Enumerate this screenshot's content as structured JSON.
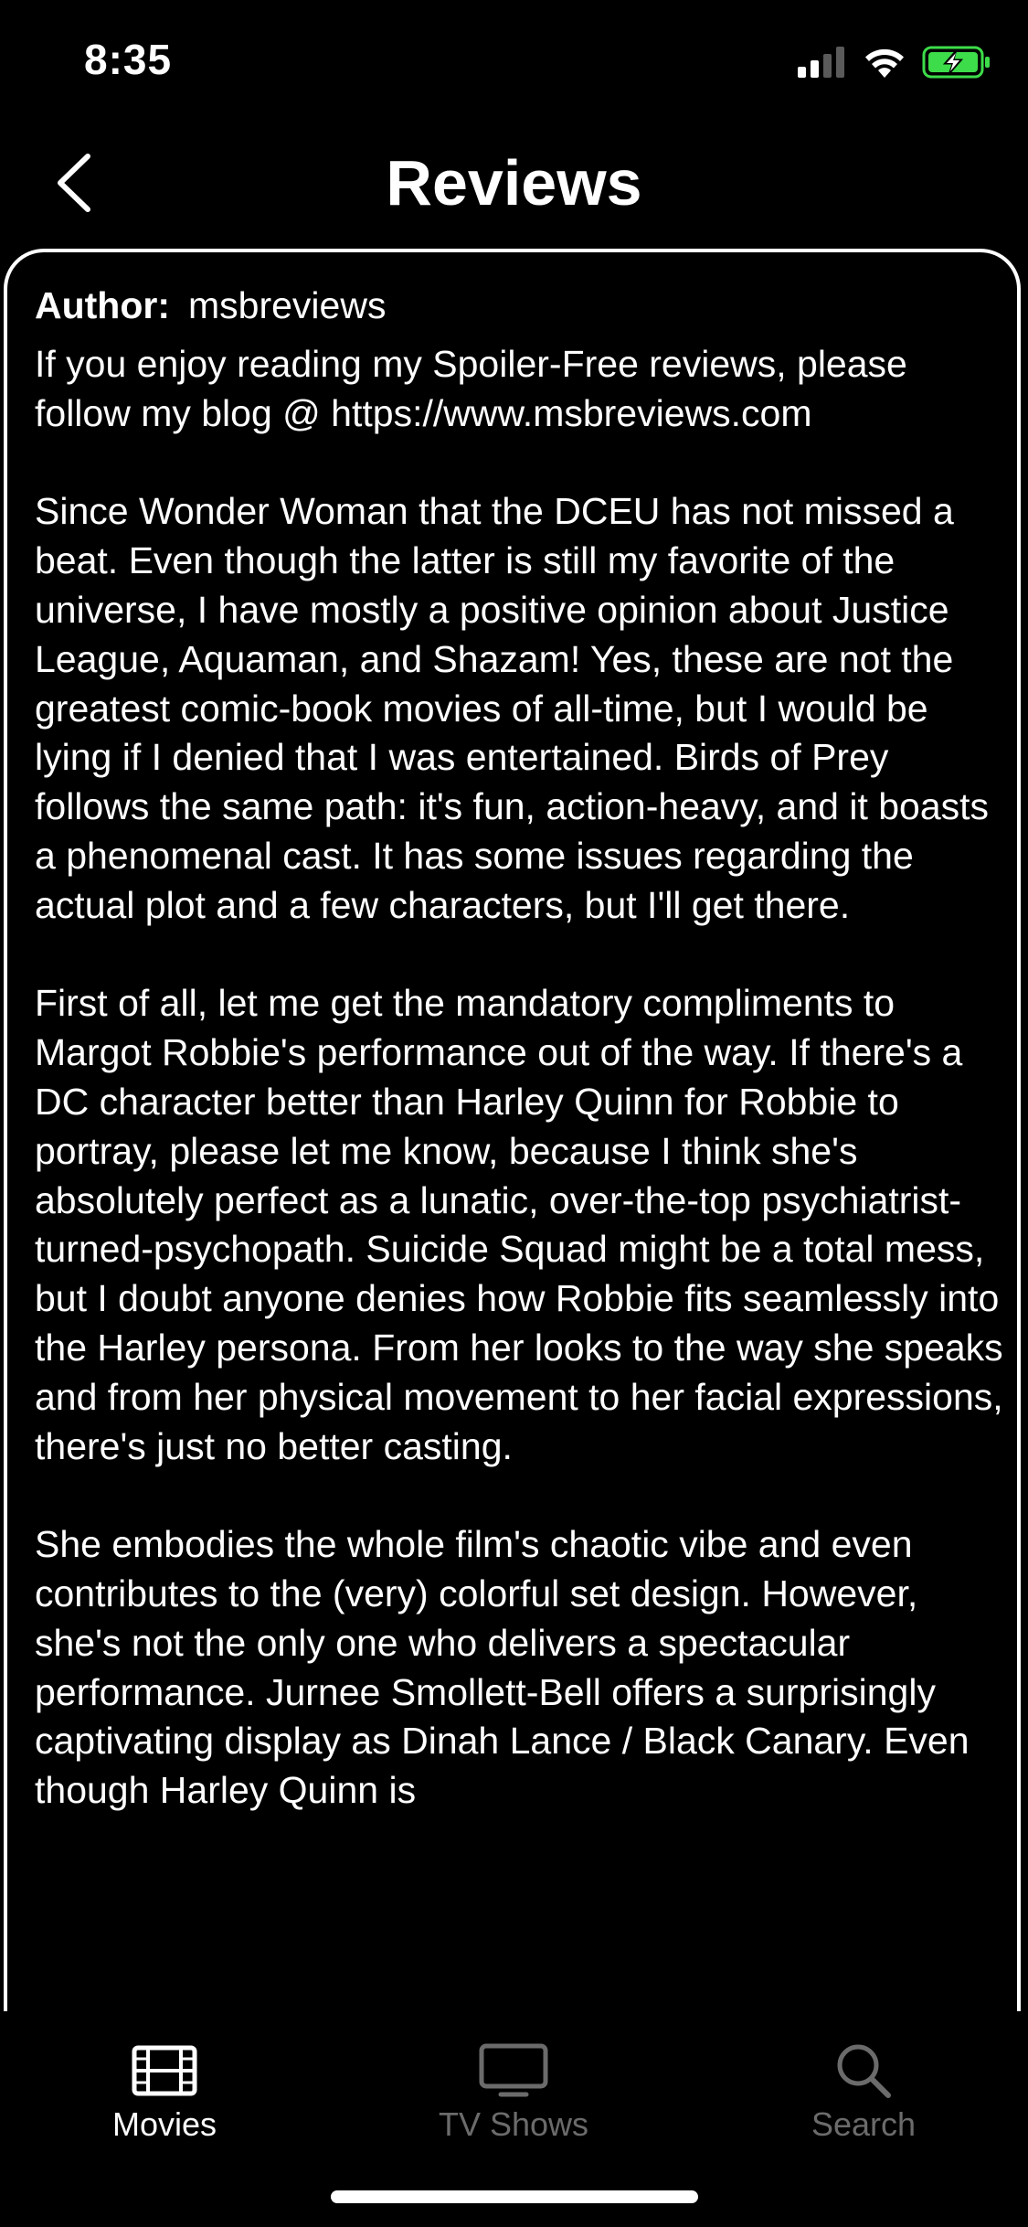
{
  "status_bar": {
    "time": "8:35",
    "icons": [
      "cellular-signal-icon",
      "wifi-icon",
      "battery-charging-icon"
    ],
    "battery_color": "#3ddc4a"
  },
  "header": {
    "title": "Reviews",
    "back_icon": "chevron-left-icon"
  },
  "review": {
    "author_label": "Author:",
    "author_name": "msbreviews",
    "text": "If you enjoy reading my Spoiler-Free reviews, please follow my blog @ https://www.msbreviews.com\n\nSince Wonder Woman that the DCEU has not missed a beat. Even though the latter is still my favorite of the universe, I have mostly a positive opinion about Justice League, Aquaman, and Shazam! Yes, these are not the greatest comic-book movies of all-time, but I would be lying if I denied that I was entertained. Birds of Prey follows the same path: it's fun, action-heavy, and it boasts a phenomenal cast. It has some issues regarding the actual plot and a few characters, but I'll get there.\n\nFirst of all, let me get the mandatory compliments to Margot Robbie's performance out of the way. If there's a DC character better than Harley Quinn for Robbie to portray, please let me know, because I think she's absolutely perfect as a lunatic, over-the-top psychiatrist-turned-psychopath. Suicide Squad might be a total mess, but I doubt anyone denies how Robbie fits seamlessly into the Harley persona. From her looks to the way she speaks and from her physical movement to her facial expressions, there's just no better casting.\n\nShe embodies the whole film's chaotic vibe and even contributes to the (very) colorful set design. However, she's not the only one who delivers a spectacular performance. Jurnee Smollett-Bell offers a surprisingly captivating display as Dinah Lance / Black Canary. Even though Harley Quinn is"
  },
  "tab_bar": {
    "tabs": [
      {
        "label": "Movies",
        "icon": "film-icon",
        "active": true
      },
      {
        "label": "TV Shows",
        "icon": "tv-icon",
        "active": false
      },
      {
        "label": "Search",
        "icon": "search-icon",
        "active": false
      }
    ],
    "active_color": "#ffffff",
    "inactive_color": "#6b6b6b"
  }
}
